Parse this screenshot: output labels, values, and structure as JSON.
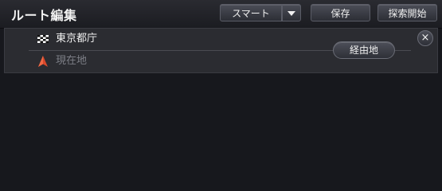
{
  "header": {
    "title": "ルート編集",
    "mode_label": "スマート",
    "save_label": "保存",
    "start_label": "探索開始"
  },
  "route": {
    "destination": {
      "label": "東京都庁",
      "icon": "checkered-flag-icon"
    },
    "origin": {
      "label": "現在地",
      "icon": "current-location-arrow-icon"
    },
    "waypoint_label": "経由地",
    "close_glyph": "×"
  },
  "colors": {
    "background": "#17181d",
    "panel": "#2b2c31",
    "origin_marker": "#d9482b"
  }
}
